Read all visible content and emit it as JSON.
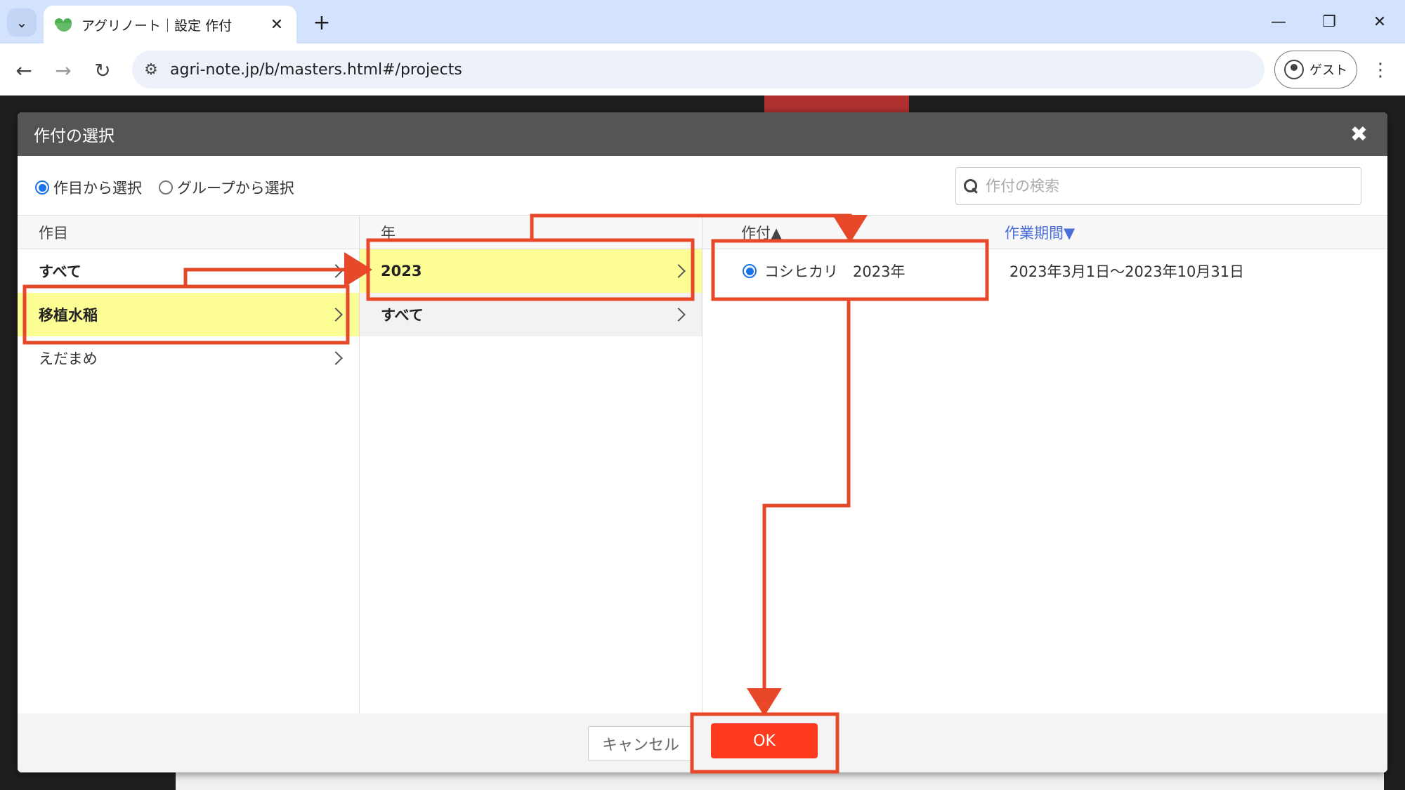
{
  "browser": {
    "tab_title": "アグリノート｜設定 作付",
    "tab_close": "✕",
    "new_tab": "+",
    "url": "agri-note.jp/b/masters.html#/projects",
    "profile_label": "ゲスト",
    "menu": "⋮",
    "window_controls": {
      "minimize": "—",
      "restore": "❐",
      "close": "✕"
    },
    "nav": {
      "back": "←",
      "forward": "→",
      "reload": "↻"
    }
  },
  "modal": {
    "title": "作付の選択",
    "close": "✖",
    "mode_options": [
      {
        "label": "作目から選択",
        "selected": true
      },
      {
        "label": "グループから選択",
        "selected": false
      }
    ],
    "search": {
      "placeholder": "作付の検索",
      "value": ""
    },
    "columns": {
      "crops": {
        "header": "作目",
        "items": [
          {
            "label": "すべて",
            "bold": true,
            "selected": false
          },
          {
            "label": "移植水稲",
            "bold": true,
            "selected": true
          },
          {
            "label": "えだまめ",
            "bold": false,
            "selected": false
          }
        ]
      },
      "years": {
        "header": "年",
        "items": [
          {
            "label": "2023",
            "bold": true,
            "selected": true
          },
          {
            "label": "すべて",
            "bold": true,
            "selected": false
          }
        ]
      },
      "plans": {
        "header_name": "作付▲",
        "header_period": "作業期間▼",
        "items": [
          {
            "name": "コシヒカリ　2023年",
            "period": "2023年3月1日〜2023年10月31日",
            "selected": true
          }
        ]
      }
    },
    "footer": {
      "cancel": "キャンセル",
      "ok": "OK"
    }
  },
  "colors": {
    "highlight_box": "#e8482a",
    "selected_row": "#fdfd96",
    "ok_button": "#ff3b1f",
    "radio_on": "#1a73e8",
    "sort_link": "#4a6fd8"
  }
}
